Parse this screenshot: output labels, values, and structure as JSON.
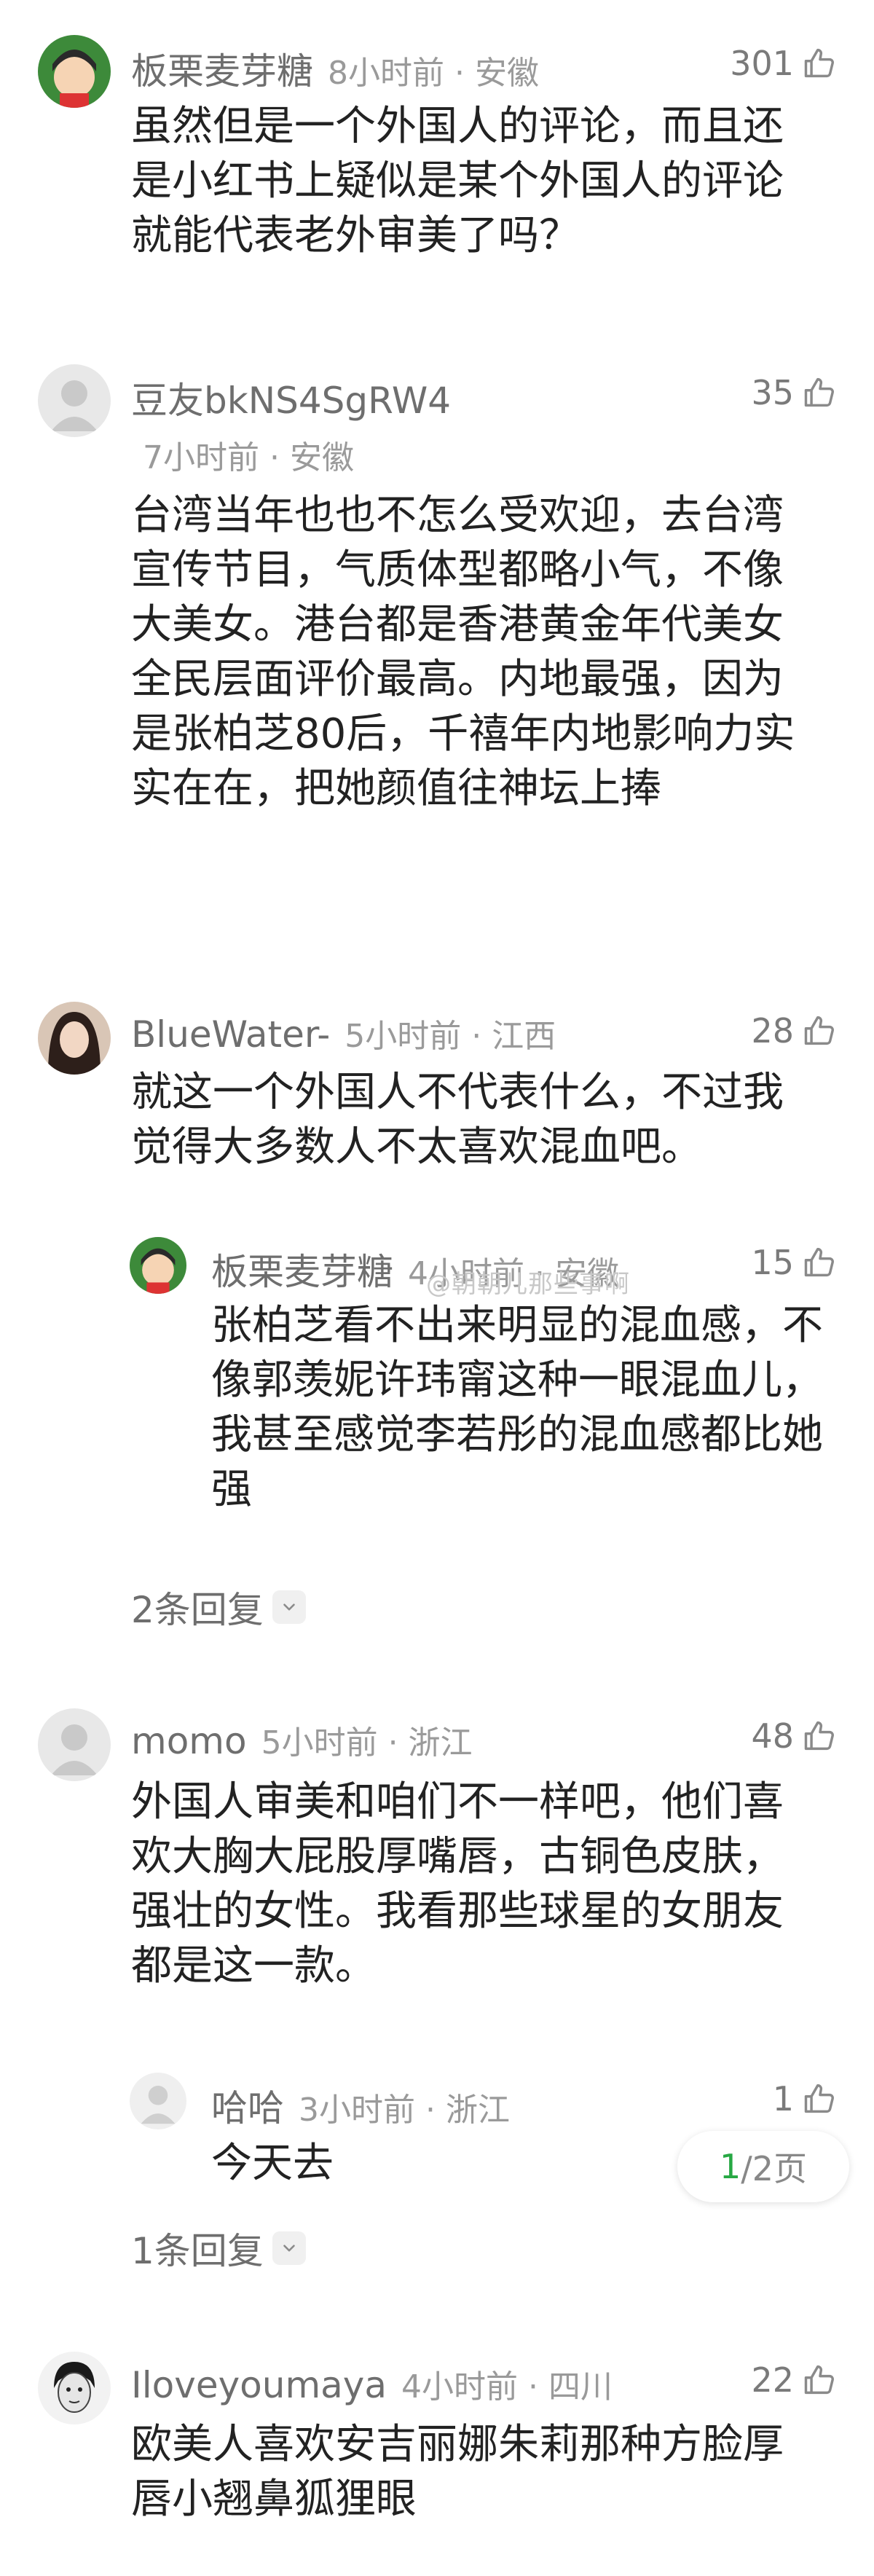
{
  "comments": [
    {
      "name": "板栗麦芽糖",
      "time": "8小时前 · 安徽",
      "likes": "301",
      "text": "虽然但是一个外国人的评论，而且还是小红书上疑似是某个外国人的评论就能代表老外审美了吗？"
    },
    {
      "name": "豆友bkNS4SgRW4",
      "time": "7小时前 · 安徽",
      "likes": "35",
      "text": "台湾当年也也不怎么受欢迎，去台湾宣传节目，气质体型都略小气，不像大美女。港台都是香港黄金年代美女全民层面评价最高。内地最强，因为是张柏芝80后，千禧年内地影响力实实在在，把她颜值往神坛上捧"
    },
    {
      "name": "BlueWater-",
      "time": "5小时前 · 江西",
      "likes": "28",
      "text": "就这一个外国人不代表什么，不过我觉得大多数人不太喜欢混血吧。",
      "reply": {
        "name": "板栗麦芽糖",
        "time": "4小时前 · 安徽",
        "likes": "15",
        "text": "张柏芝看不出来明显的混血感，不像郭羡妮许玮甯这种一眼混血儿，我甚至感觉李若彤的混血感都比她强"
      },
      "more": "2条回复"
    },
    {
      "name": "momo",
      "time": "5小时前 · 浙江",
      "likes": "48",
      "text": "外国人审美和咱们不一样吧，他们喜欢大胸大屁股厚嘴唇，古铜色皮肤，强壮的女性。我看那些球星的女朋友都是这一款。",
      "reply": {
        "name": "哈哈",
        "time": "3小时前 · 浙江",
        "likes": "1",
        "text": "今天去"
      },
      "more": "1条回复"
    },
    {
      "name": "Iloveyoumaya",
      "time": "4小时前 · 四川",
      "likes": "22",
      "text": "欧美人喜欢安吉丽娜朱莉那种方脸厚唇小翘鼻狐狸眼"
    }
  ],
  "watermark": "@朝朝儿那些事啊",
  "pager": {
    "current": "1",
    "rest": "/2页"
  },
  "colors": {
    "accent": "#27a844",
    "name": "#6e6e6e",
    "meta": "#9a9a9a"
  },
  "icons": [
    "like-thumb-icon",
    "chevron-down-icon"
  ]
}
